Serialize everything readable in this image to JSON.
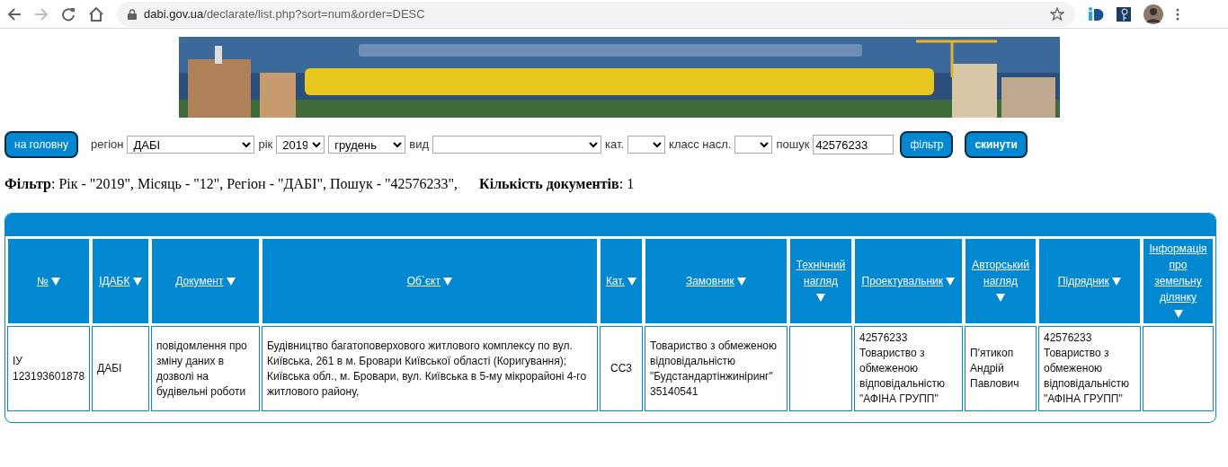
{
  "browser": {
    "url_host": "dabi.gov.ua",
    "url_path": "/declarate/list.php?sort=num&order=DESC"
  },
  "toolbar": {
    "home_button": "на головну",
    "filters": [
      {
        "kind": "select",
        "label": "регіон",
        "value": "ДАБІ"
      },
      {
        "kind": "select",
        "label": "рік",
        "value": "2019"
      },
      {
        "kind": "select",
        "value": "грудень"
      },
      {
        "kind": "select",
        "label": "вид"
      },
      {
        "kind": "select",
        "label": "кат."
      },
      {
        "kind": "select",
        "label": "класс насл."
      },
      {
        "kind": "input",
        "label": "пошук",
        "value": "42576233"
      }
    ],
    "filter_button": "фільтр",
    "reset_button": "скинути"
  },
  "summary": {
    "filter": "**Фільтр**: Рік - \"2019\", Місяць - \"12\", Регіон - \"ДАБІ\", Пошук - \"42576233\",",
    "count": "**Кількість документів**: 1"
  },
  "table": {
    "columns": [
      "№",
      "ІДАБК",
      "Документ",
      "Об`єкт",
      "Кат.",
      "Замовник",
      "Технічний нагляд",
      "Проектувальник",
      "Авторський нагляд",
      "Підрядник",
      "Інформація про земельну ділянку"
    ],
    "rows": [
      [
        "ІУ 123193601878",
        "ДАБІ",
        "повідомлення про зміну даних в дозволі на будівельні роботи",
        "Будівництво багатоповерхового житлового комплексу по вул. Київська, 261 в м. Бровари Київської області (Коригування); Київська обл., м. Бровари, вул. Київська в 5-му мікрорайоні 4-го житлового району,",
        "СС3",
        "Товариство з обмеженою відповідальністю \"Будстандартінжиніринг\" 35140541",
        "",
        "42576233 Товариство з обмеженою відповідальністю \"АФІНА ГРУПП\"",
        "П'ятикоп Андрій Павлович",
        "42576233 Товариство з обмеженою відповідальністю \"АФІНА ГРУПП\"",
        ""
      ]
    ]
  }
}
